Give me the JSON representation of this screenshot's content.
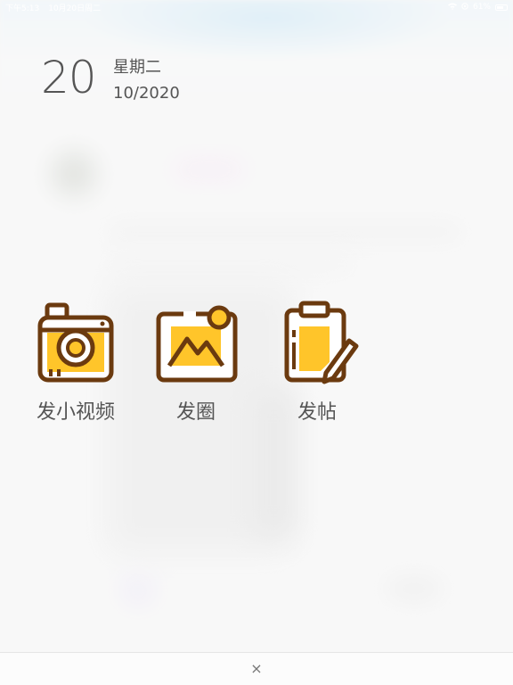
{
  "status_bar": {
    "time": "下午5:13",
    "date": "10月20日周二",
    "battery": "61%"
  },
  "header": {
    "day": "20",
    "weekday": "星期二",
    "month_year": "10/2020"
  },
  "actions": [
    {
      "label": "发小视频",
      "icon": "camera-icon"
    },
    {
      "label": "发圈",
      "icon": "image-icon"
    },
    {
      "label": "发帖",
      "icon": "clipboard-pen-icon"
    }
  ],
  "colors": {
    "icon_stroke": "#6b3a0f",
    "icon_fill": "#ffc52a",
    "text": "#555555"
  },
  "bottom_bar": {
    "close_symbol": "×"
  }
}
